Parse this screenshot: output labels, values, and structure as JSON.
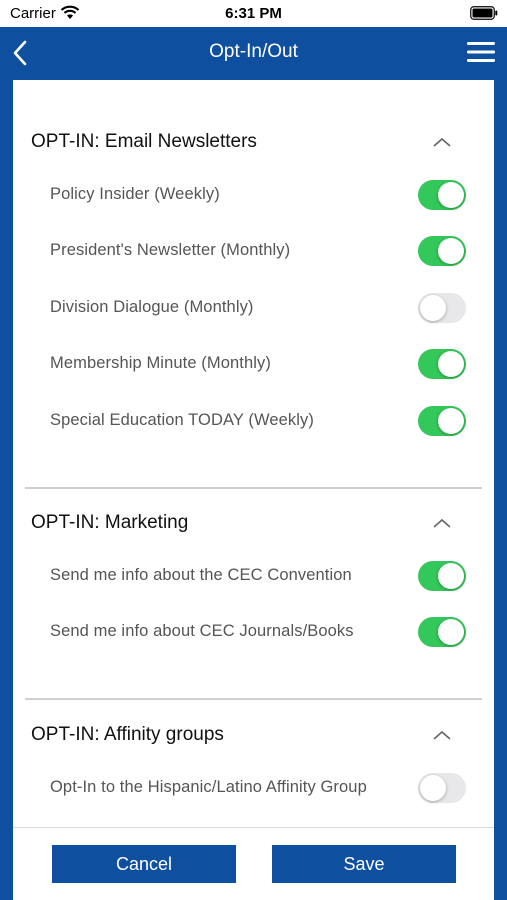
{
  "status_bar": {
    "carrier": "Carrier",
    "time": "6:31 PM"
  },
  "nav": {
    "title": "Opt-In/Out",
    "back_icon": "chevron-left-icon",
    "menu_icon": "hamburger-menu-icon"
  },
  "colors": {
    "brand_blue": "#0f4fa0",
    "toggle_on": "#34c759",
    "toggle_off": "#e8e8ea"
  },
  "sections": [
    {
      "title": "OPT-IN: Email Newsletters",
      "expanded": true,
      "items": [
        {
          "label": "Policy Insider (Weekly)",
          "on": true
        },
        {
          "label": "President's Newsletter (Monthly)",
          "on": true
        },
        {
          "label": "Division Dialogue (Monthly)",
          "on": false
        },
        {
          "label": "Membership Minute (Monthly)",
          "on": true
        },
        {
          "label": "Special Education TODAY (Weekly)",
          "on": true
        }
      ]
    },
    {
      "title": "OPT-IN: Marketing",
      "expanded": true,
      "items": [
        {
          "label": "Send me info about the CEC Convention",
          "on": true
        },
        {
          "label": "Send me info about CEC Journals/Books",
          "on": true
        }
      ]
    },
    {
      "title": "OPT-IN: Affinity groups",
      "expanded": true,
      "items": [
        {
          "label": "Opt-In to the Hispanic/Latino Affinity Group",
          "on": false
        }
      ]
    }
  ],
  "footer": {
    "cancel_label": "Cancel",
    "save_label": "Save"
  }
}
